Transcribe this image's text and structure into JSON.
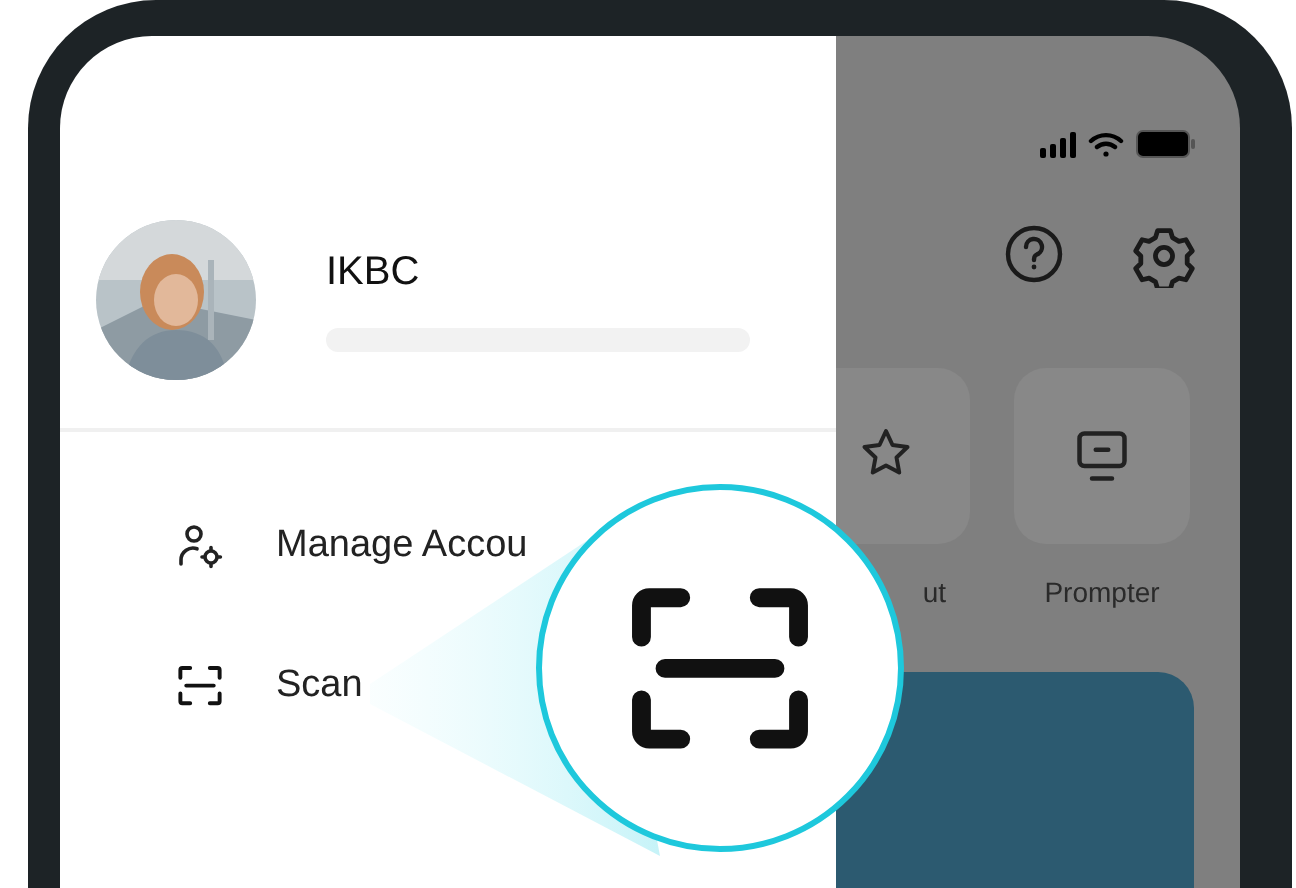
{
  "profile": {
    "name": "IKBC"
  },
  "menu": [
    {
      "label": "Manage Accou",
      "kind": "account"
    },
    {
      "label": "Scan",
      "kind": "scan"
    }
  ],
  "tools": [
    {
      "label": "ut",
      "kind": "star"
    },
    {
      "label": "Prompter",
      "kind": "monitor"
    }
  ],
  "callout": {
    "kind": "scan"
  }
}
